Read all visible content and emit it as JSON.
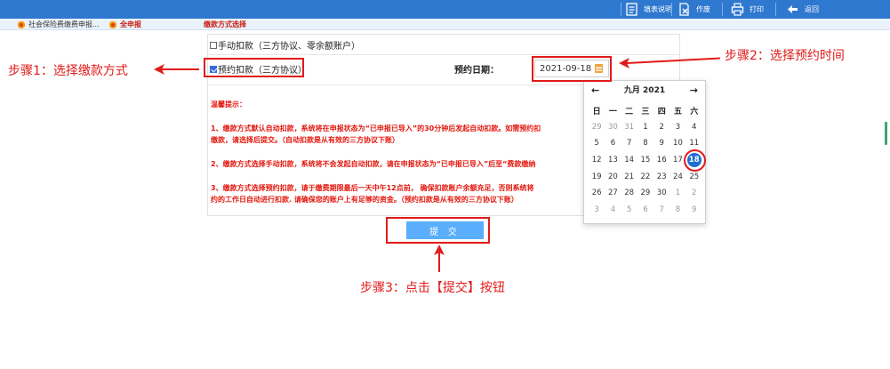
{
  "toolbar": {
    "help_label": "填表说明",
    "cancel_label": "作废",
    "print_label": "打印",
    "back_label": "返回"
  },
  "tabs": [
    {
      "label": "社会保险费缴费申报..."
    },
    {
      "label": "全申报"
    },
    {
      "label": "缴款方式选择"
    }
  ],
  "form": {
    "manual_option": "手动扣款（三方协议、零余额账户）",
    "scheduled_option": "预约扣款（三方协议）",
    "date_label": "预约日期：",
    "date_value": "2021-09-18",
    "notice_title": "温馨提示：",
    "notice_1a": "1、缴款方式默认自动扣款，系统将在申报状态为“已申报已导入”的30分钟后发起自动扣款。如需预约扣",
    "notice_1b": "缴款，请选择后提交。（自动扣款是从有效的三方协议下账）",
    "notice_2": "2、缴款方式选择手动扣款，系统将不会发起自动扣款，请在申报状态为“已申报已导入”后至“费款缴纳",
    "notice_3a": "3、缴款方式选择预约扣款，请于缴费期限最后一天中午12点前， 确保扣款账户余额充足，否则系统将",
    "notice_3b": "约的工作日自动进行扣款. 请确保您的账户上有足够的资金。（预约扣款是从有效的三方协议下账）",
    "submit_label": "提 交"
  },
  "datepicker": {
    "prev": "←",
    "next": "→",
    "month_label": "九月 2021",
    "weekdays": [
      "日",
      "一",
      "二",
      "三",
      "四",
      "五",
      "六"
    ],
    "weeks": [
      [
        "29",
        "30",
        "31",
        "1",
        "2",
        "3",
        "4"
      ],
      [
        "5",
        "6",
        "7",
        "8",
        "9",
        "10",
        "11"
      ],
      [
        "12",
        "13",
        "14",
        "15",
        "16",
        "17",
        "18"
      ],
      [
        "19",
        "20",
        "21",
        "22",
        "23",
        "24",
        "25"
      ],
      [
        "26",
        "27",
        "28",
        "29",
        "30",
        "1",
        "2"
      ],
      [
        "3",
        "4",
        "5",
        "6",
        "7",
        "8",
        "9"
      ]
    ],
    "selected": "18"
  },
  "annotations": {
    "step1": "步骤1：选择缴款方式",
    "step2": "步骤2：选择预约时间",
    "step3": "步骤3：点击【提交】按钮"
  },
  "colors": {
    "toolbar": "#2f78d0",
    "annotation": "#e11a1a",
    "submit": "#5aaefc",
    "selected_day": "#1f6fd1"
  }
}
